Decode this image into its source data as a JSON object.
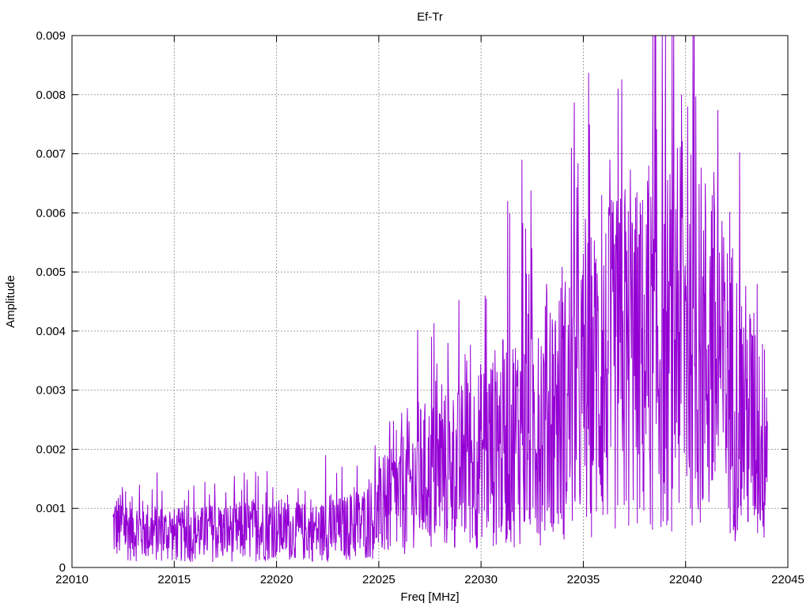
{
  "chart_data": {
    "type": "line",
    "title": "Ef-Tr",
    "xlabel": "Freq [MHz]",
    "ylabel": "Amplitude",
    "xlim": [
      22010,
      22045
    ],
    "ylim": [
      0,
      0.009
    ],
    "xticks": [
      22010,
      22015,
      22020,
      22025,
      22030,
      22035,
      22040,
      22045
    ],
    "yticks": [
      0,
      0.001,
      0.002,
      0.003,
      0.004,
      0.005,
      0.006,
      0.007,
      0.008,
      0.009
    ],
    "ytick_labels": [
      "0",
      "0.001",
      "0.002",
      "0.003",
      "0.004",
      "0.005",
      "0.006",
      "0.007",
      "0.008",
      "0.009"
    ],
    "grid": true,
    "series": [
      {
        "color": "#9400d3",
        "x_range": [
          22012.0,
          22044.0
        ],
        "x_step": 0.02,
        "envelope_points": [
          [
            22012.0,
            0.0007
          ],
          [
            22013.0,
            0.00065
          ],
          [
            22014.0,
            0.0006
          ],
          [
            22015.0,
            0.00055
          ],
          [
            22016.0,
            0.00055
          ],
          [
            22017.0,
            0.0006
          ],
          [
            22018.0,
            0.0006
          ],
          [
            22019.0,
            0.00065
          ],
          [
            22020.0,
            0.00065
          ],
          [
            22021.0,
            0.0006
          ],
          [
            22022.0,
            0.0006
          ],
          [
            22023.0,
            0.00065
          ],
          [
            22024.0,
            0.0007
          ],
          [
            22025.0,
            0.0009
          ],
          [
            22026.0,
            0.0012
          ],
          [
            22027.0,
            0.0015
          ],
          [
            22028.0,
            0.0016
          ],
          [
            22029.0,
            0.0017
          ],
          [
            22030.0,
            0.0019
          ],
          [
            22031.0,
            0.0021
          ],
          [
            22032.0,
            0.0023
          ],
          [
            22033.0,
            0.0025
          ],
          [
            22034.0,
            0.0027
          ],
          [
            22035.0,
            0.003
          ],
          [
            22036.0,
            0.0033
          ],
          [
            22037.0,
            0.0035
          ],
          [
            22038.0,
            0.0035
          ],
          [
            22039.0,
            0.0037
          ],
          [
            22040.0,
            0.0039
          ],
          [
            22041.0,
            0.0037
          ],
          [
            22042.0,
            0.0031
          ],
          [
            22043.0,
            0.0026
          ],
          [
            22044.0,
            0.002
          ]
        ],
        "peaks": [
          [
            22013.3,
            0.0014
          ],
          [
            22014.4,
            0.0013
          ],
          [
            22016.5,
            0.00145
          ],
          [
            22019.1,
            0.00155
          ],
          [
            22021.4,
            0.0013
          ],
          [
            22022.4,
            0.0019
          ],
          [
            22025.3,
            0.0019
          ],
          [
            22026.4,
            0.0027
          ],
          [
            22028.0,
            0.0026
          ],
          [
            22029.3,
            0.0035
          ],
          [
            22030.2,
            0.0046
          ],
          [
            22031.3,
            0.0062
          ],
          [
            22032.0,
            0.0069
          ],
          [
            22033.2,
            0.0048
          ],
          [
            22034.4,
            0.0041
          ],
          [
            22035.1,
            0.0059
          ],
          [
            22035.9,
            0.0063
          ],
          [
            22036.3,
            0.0069
          ],
          [
            22036.7,
            0.0081
          ],
          [
            22037.4,
            0.0058
          ],
          [
            22038.2,
            0.0068
          ],
          [
            22039.1,
            0.0054
          ],
          [
            22039.6,
            0.0071
          ],
          [
            22039.8,
            0.008
          ],
          [
            22040.1,
            0.0078
          ],
          [
            22041.3,
            0.0063
          ],
          [
            22042.3,
            0.0054
          ],
          [
            22043.5,
            0.0048
          ]
        ]
      }
    ]
  }
}
